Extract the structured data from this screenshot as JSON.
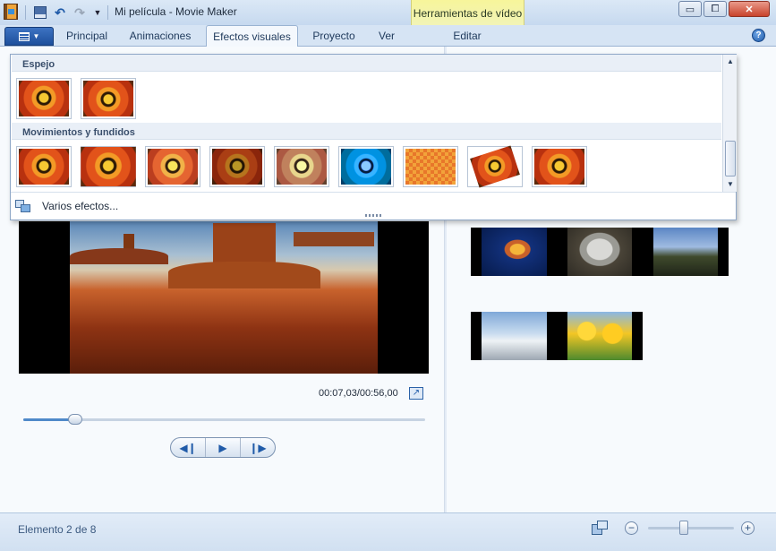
{
  "window": {
    "title": "Mi película - Movie Maker",
    "contextual_group": "Herramientas de vídeo"
  },
  "quick_access": [
    "save-icon",
    "undo-icon",
    "redo-icon",
    "customize-icon"
  ],
  "window_controls": {
    "minimize": "▭",
    "maximize": "⧠",
    "close": "✕"
  },
  "ribbon": {
    "tabs": [
      {
        "label": "Principal",
        "active": false
      },
      {
        "label": "Animaciones",
        "active": false
      },
      {
        "label": "Efectos visuales",
        "active": true
      },
      {
        "label": "Proyecto",
        "active": false
      },
      {
        "label": "Ver",
        "active": false
      },
      {
        "label": "Editar",
        "active": false
      }
    ],
    "help": "?"
  },
  "effects_gallery": {
    "groups": [
      {
        "title": "Espejo",
        "item_count": 2
      },
      {
        "title": "Movimientos y fundidos",
        "item_count": 9
      }
    ],
    "more_effects": "Varios efectos..."
  },
  "preview": {
    "time": "00:07,03/00:56,00",
    "progress": 0.13
  },
  "storyboard": {
    "clips": [
      [
        "jellyfish",
        "koala",
        "lighthouse"
      ],
      [
        "penguins",
        "tulips"
      ]
    ]
  },
  "status": {
    "item_text": "Elemento 2 de 8",
    "zoom_level": 0.42
  },
  "colors": {
    "accent": "#1f5aa8",
    "contextual_tab": "#f7f59a",
    "close_button": "#c8432c"
  }
}
